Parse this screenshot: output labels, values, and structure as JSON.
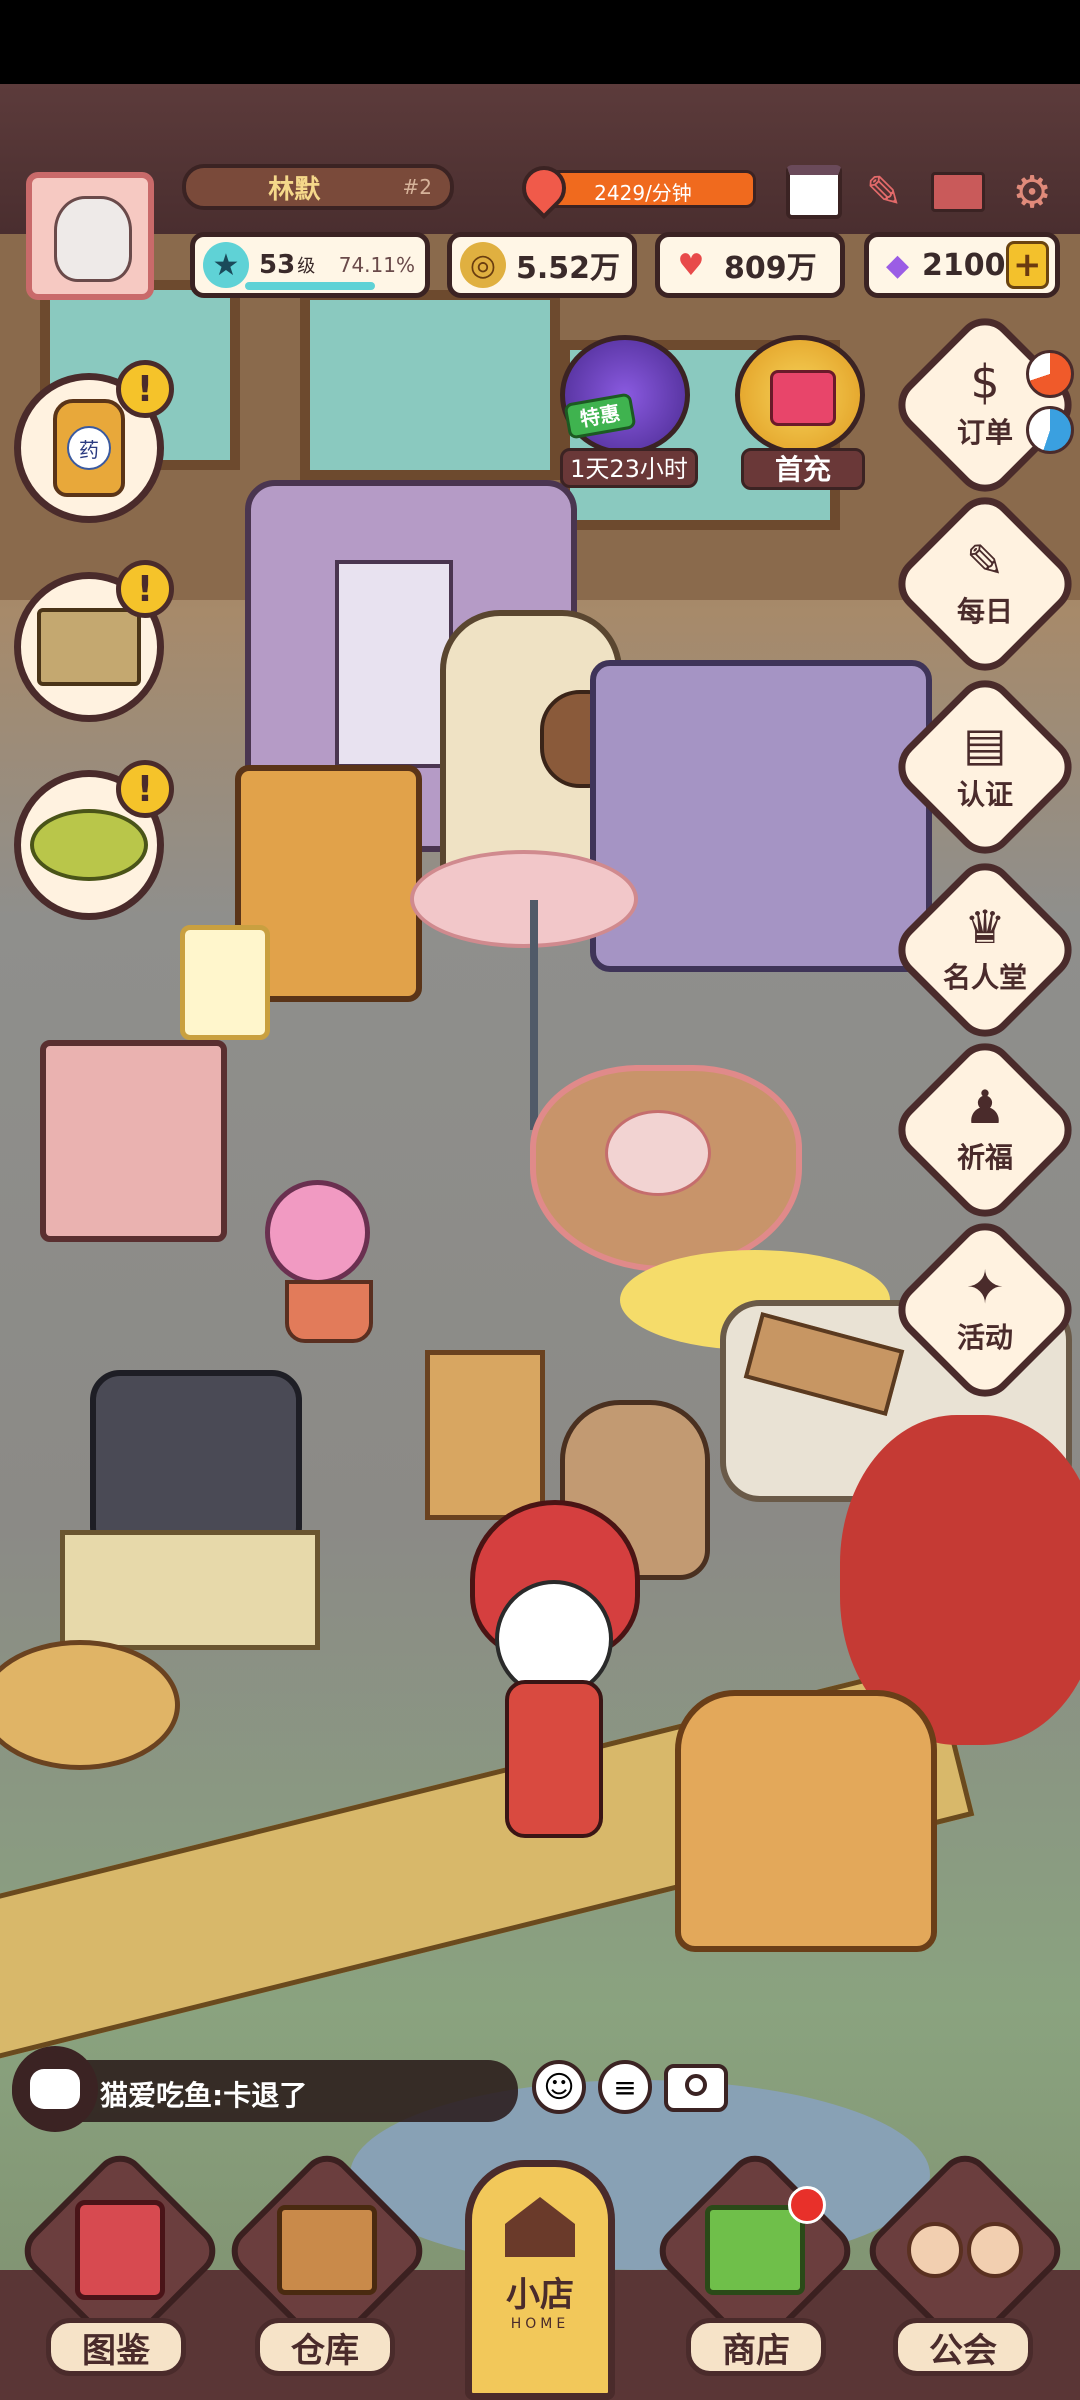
{
  "player": {
    "name": "林默",
    "server_tag": "#2",
    "level": "53",
    "level_unit": "级",
    "exp_percent": "74.11%"
  },
  "income": {
    "rate": "2429/分钟"
  },
  "currencies": {
    "coins": "5.52万",
    "hearts": "809万",
    "gems": "2100",
    "add_label": "+"
  },
  "promos": {
    "special": {
      "badge": "特惠",
      "timer": "1天23小时"
    },
    "first_charge": {
      "label": "首充"
    }
  },
  "side_menu": [
    {
      "label": "订单",
      "icon": "order-book-icon",
      "glyph": "$"
    },
    {
      "label": "每日",
      "icon": "daily-task-icon",
      "glyph": "✎"
    },
    {
      "label": "认证",
      "icon": "id-card-icon",
      "glyph": "▤"
    },
    {
      "label": "名人堂",
      "icon": "trophy-icon",
      "glyph": "♛"
    },
    {
      "label": "祈福",
      "icon": "prayer-icon",
      "glyph": "♟"
    },
    {
      "label": "活动",
      "icon": "event-icon",
      "glyph": "✦"
    }
  ],
  "left_quests": [
    {
      "icon": "medicine-bottle-icon",
      "bottle_label": "药",
      "alert": "!"
    },
    {
      "icon": "shrine-icon",
      "alert": "!"
    },
    {
      "icon": "island-icon",
      "alert": "!"
    }
  ],
  "chat": {
    "message": "猫爱吃鱼:卡退了"
  },
  "bottom_nav": [
    {
      "label": "图鉴",
      "icon": "collection-book-icon"
    },
    {
      "label": "仓库",
      "icon": "warehouse-box-icon"
    },
    {
      "label": "小店",
      "sub": "HOME",
      "icon": "shop-house-icon"
    },
    {
      "label": "商店",
      "icon": "store-stall-icon"
    },
    {
      "label": "公会",
      "icon": "guild-couple-icon"
    }
  ],
  "colors": {
    "frame": "#4a2b2b",
    "panel": "#fff2e0",
    "income_bar": "#f06a1e",
    "gold": "#f5c32a",
    "gem": "#9b5de5"
  }
}
